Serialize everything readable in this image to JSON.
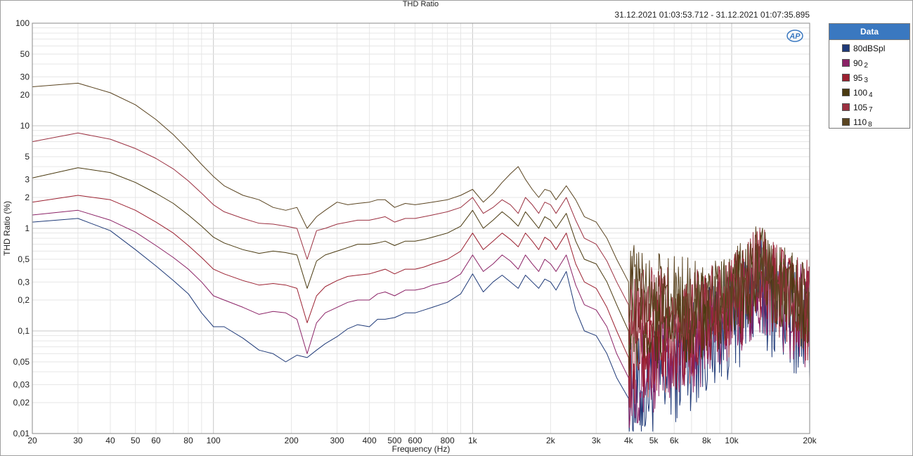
{
  "chart_data": {
    "type": "line",
    "title": "THD Ratio",
    "date_range": "31.12.2021 01:03:53.712 - 31.12.2021 01:07:35.895",
    "xlabel": "Frequency (Hz)",
    "ylabel": "THD Ratio (%)",
    "xscale": "log",
    "yscale": "log",
    "xlim": [
      20,
      20000
    ],
    "ylim": [
      0.01,
      100
    ],
    "grid": true,
    "legend_position": "right",
    "legend_title": "Data",
    "x_ticks": [
      {
        "v": 20,
        "label": "20"
      },
      {
        "v": 30,
        "label": "30"
      },
      {
        "v": 40,
        "label": "40"
      },
      {
        "v": 50,
        "label": "50"
      },
      {
        "v": 60,
        "label": "60"
      },
      {
        "v": 80,
        "label": "80"
      },
      {
        "v": 100,
        "label": "100"
      },
      {
        "v": 200,
        "label": "200"
      },
      {
        "v": 300,
        "label": "300"
      },
      {
        "v": 400,
        "label": "400"
      },
      {
        "v": 500,
        "label": "500"
      },
      {
        "v": 600,
        "label": "600"
      },
      {
        "v": 800,
        "label": "800"
      },
      {
        "v": 1000,
        "label": "1k"
      },
      {
        "v": 2000,
        "label": "2k"
      },
      {
        "v": 3000,
        "label": "3k"
      },
      {
        "v": 4000,
        "label": "4k"
      },
      {
        "v": 5000,
        "label": "5k"
      },
      {
        "v": 6000,
        "label": "6k"
      },
      {
        "v": 8000,
        "label": "8k"
      },
      {
        "v": 10000,
        "label": "10k"
      },
      {
        "v": 20000,
        "label": "20k"
      }
    ],
    "y_ticks": [
      {
        "v": 100,
        "label": "100"
      },
      {
        "v": 50,
        "label": "50"
      },
      {
        "v": 30,
        "label": "30"
      },
      {
        "v": 20,
        "label": "20"
      },
      {
        "v": 10,
        "label": "10"
      },
      {
        "v": 5,
        "label": "5"
      },
      {
        "v": 3,
        "label": "3"
      },
      {
        "v": 2,
        "label": "2"
      },
      {
        "v": 1,
        "label": "1"
      },
      {
        "v": 0.5,
        "label": "0,5"
      },
      {
        "v": 0.3,
        "label": "0,3"
      },
      {
        "v": 0.2,
        "label": "0,2"
      },
      {
        "v": 0.1,
        "label": "0,1"
      },
      {
        "v": 0.05,
        "label": "0,05"
      },
      {
        "v": 0.03,
        "label": "0,03"
      },
      {
        "v": 0.02,
        "label": "0,02"
      },
      {
        "v": 0.01,
        "label": "0,01"
      }
    ],
    "base_x": [
      20,
      30,
      40,
      50,
      60,
      70,
      80,
      90,
      100,
      110,
      130,
      150,
      170,
      190,
      210,
      230,
      250,
      270,
      300,
      330,
      360,
      400,
      430,
      460,
      500,
      550,
      600,
      650,
      700,
      800,
      900,
      1000,
      1100,
      1200,
      1300,
      1400,
      1500,
      1600,
      1700,
      1800,
      1900,
      2000,
      2100,
      2300,
      2500,
      2700,
      3000,
      3300,
      3600,
      4000
    ],
    "series": [
      {
        "name": "80dBSpl",
        "sub": "",
        "color": "#1f3a78",
        "noise_amp": 0.55,
        "values": [
          1.15,
          1.25,
          0.95,
          0.62,
          0.43,
          0.31,
          0.23,
          0.15,
          0.11,
          0.11,
          0.085,
          0.065,
          0.06,
          0.05,
          0.058,
          0.055,
          0.065,
          0.075,
          0.088,
          0.105,
          0.115,
          0.11,
          0.13,
          0.13,
          0.135,
          0.15,
          0.15,
          0.16,
          0.17,
          0.19,
          0.23,
          0.36,
          0.24,
          0.3,
          0.35,
          0.3,
          0.26,
          0.35,
          0.3,
          0.26,
          0.32,
          0.3,
          0.25,
          0.38,
          0.16,
          0.1,
          0.09,
          0.06,
          0.035,
          0.022
        ]
      },
      {
        "name": "90",
        "sub": "2",
        "color": "#8b2266",
        "noise_amp": 0.5,
        "values": [
          1.35,
          1.5,
          1.2,
          0.92,
          0.68,
          0.52,
          0.4,
          0.3,
          0.22,
          0.2,
          0.17,
          0.145,
          0.155,
          0.15,
          0.13,
          0.06,
          0.12,
          0.15,
          0.17,
          0.19,
          0.2,
          0.2,
          0.23,
          0.24,
          0.22,
          0.25,
          0.25,
          0.26,
          0.28,
          0.3,
          0.36,
          0.55,
          0.38,
          0.45,
          0.55,
          0.48,
          0.4,
          0.55,
          0.45,
          0.38,
          0.5,
          0.45,
          0.38,
          0.55,
          0.28,
          0.18,
          0.16,
          0.11,
          0.06,
          0.035
        ]
      },
      {
        "name": "95",
        "sub": "3",
        "color": "#9b2030",
        "noise_amp": 0.5,
        "values": [
          1.8,
          2.1,
          1.9,
          1.5,
          1.15,
          0.9,
          0.68,
          0.52,
          0.4,
          0.36,
          0.31,
          0.28,
          0.29,
          0.28,
          0.26,
          0.12,
          0.22,
          0.27,
          0.31,
          0.34,
          0.35,
          0.36,
          0.38,
          0.4,
          0.36,
          0.4,
          0.4,
          0.42,
          0.45,
          0.5,
          0.6,
          0.9,
          0.62,
          0.75,
          0.9,
          0.78,
          0.66,
          0.9,
          0.75,
          0.62,
          0.82,
          0.75,
          0.62,
          0.9,
          0.45,
          0.3,
          0.26,
          0.17,
          0.1,
          0.055
        ]
      },
      {
        "name": "100",
        "sub": "4",
        "color": "#4a3a10",
        "noise_amp": 0.45,
        "values": [
          3.1,
          3.9,
          3.5,
          2.8,
          2.2,
          1.75,
          1.35,
          1.05,
          0.82,
          0.72,
          0.62,
          0.57,
          0.6,
          0.58,
          0.55,
          0.26,
          0.48,
          0.55,
          0.6,
          0.65,
          0.7,
          0.7,
          0.72,
          0.75,
          0.68,
          0.75,
          0.75,
          0.78,
          0.82,
          0.9,
          1.05,
          1.5,
          1.0,
          1.2,
          1.45,
          1.25,
          1.05,
          1.45,
          1.2,
          1.0,
          1.3,
          1.2,
          1.0,
          1.4,
          0.75,
          0.5,
          0.45,
          0.3,
          0.18,
          0.1
        ]
      },
      {
        "name": "105",
        "sub": "7",
        "color": "#9b3040",
        "noise_amp": 0.4,
        "values": [
          7.0,
          8.5,
          7.4,
          6.0,
          4.8,
          3.8,
          2.9,
          2.2,
          1.7,
          1.45,
          1.25,
          1.12,
          1.1,
          1.05,
          1.0,
          0.5,
          0.95,
          1.0,
          1.1,
          1.15,
          1.2,
          1.2,
          1.25,
          1.3,
          1.15,
          1.25,
          1.25,
          1.3,
          1.35,
          1.45,
          1.6,
          2.0,
          1.4,
          1.6,
          1.9,
          1.7,
          1.4,
          2.0,
          1.7,
          1.4,
          1.8,
          1.7,
          1.4,
          2.0,
          1.2,
          0.8,
          0.7,
          0.48,
          0.3,
          0.18
        ]
      },
      {
        "name": "110",
        "sub": "8",
        "color": "#5a4420",
        "noise_amp": 0.4,
        "values": [
          24,
          26,
          21,
          16,
          11.5,
          8.2,
          5.8,
          4.2,
          3.2,
          2.6,
          2.1,
          1.9,
          1.6,
          1.5,
          1.6,
          1.0,
          1.3,
          1.5,
          1.8,
          1.7,
          1.75,
          1.8,
          1.9,
          1.9,
          1.6,
          1.75,
          1.7,
          1.75,
          1.8,
          1.9,
          2.1,
          2.4,
          1.8,
          2.2,
          2.8,
          3.4,
          4.0,
          3.0,
          2.4,
          2.0,
          2.4,
          2.3,
          1.9,
          2.6,
          1.9,
          1.3,
          1.15,
          0.8,
          0.5,
          0.3
        ]
      }
    ],
    "hf_envelope": {
      "x": [
        4000,
        5000,
        6000,
        7000,
        8000,
        9000,
        10000,
        11000,
        12000,
        13000,
        14000,
        15000,
        17000,
        20000
      ],
      "values": [
        0.15,
        0.15,
        0.16,
        0.17,
        0.18,
        0.2,
        0.22,
        0.3,
        0.4,
        0.45,
        0.38,
        0.3,
        0.25,
        0.2
      ]
    }
  }
}
